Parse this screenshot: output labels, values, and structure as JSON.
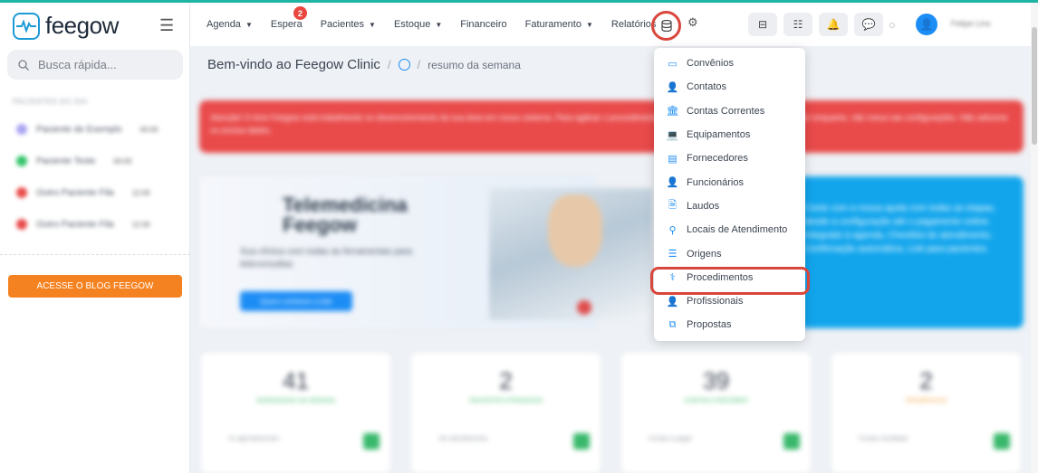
{
  "app": {
    "logo_text": "feegow"
  },
  "search": {
    "placeholder": "Busca rápida..."
  },
  "sidebar": {
    "section_title": "PACIENTES DO DIA",
    "patients": [
      {
        "name": "Paciente de Exemplo",
        "badge": "00:00",
        "color": "#a9a4f2"
      },
      {
        "name": "Paciente Teste",
        "badge": "00:00",
        "color": "#33c46a"
      },
      {
        "name": "Outro Paciente Fila",
        "badge": "12:00",
        "color": "#e94a4a"
      },
      {
        "name": "Outro Paciente Fila",
        "badge": "12:00",
        "color": "#e94a4a"
      }
    ],
    "blog_button": "ACESSE O BLOG FEEGOW"
  },
  "nav": {
    "items": [
      {
        "label": "Agenda",
        "has_caret": true
      },
      {
        "label": "Espera",
        "has_caret": false,
        "badge": "2"
      },
      {
        "label": "Pacientes",
        "has_caret": true
      },
      {
        "label": "Estoque",
        "has_caret": true
      },
      {
        "label": "Financeiro",
        "has_caret": false
      },
      {
        "label": "Faturamento",
        "has_caret": true
      },
      {
        "label": "Relatórios",
        "has_caret": false
      }
    ],
    "caret_glyph": "▼",
    "username": "Felipe Lins"
  },
  "breadcrumb": {
    "title": "Bem-vindo ao Feegow Clinic",
    "separator": "/",
    "subtitle": "resumo da semana"
  },
  "alert": {
    "text": "Atenção! O time Feegow está trabalhando no desenvolvimento da sua área em nosso sistema. Para agilizar o procedimento deste processo, pedimos o seu apoio por enquanto, não mexa nas configurações. Não adicione ou exclua dados."
  },
  "banner": {
    "title_line1": "Telemedicina",
    "title_line2": "Feegow",
    "text": "Sua clínica com todas as ferramentas para teleconsultas",
    "button": "Quero conhecer a tele",
    "right_text": "Conte com a nossa ajuda com todas as etapas, desde a configuração até o pagamento online. Integrado à agenda, Checklist de atendimento, Confirmação automática, Link para pacientes."
  },
  "cards": [
    {
      "number": "41",
      "label": "Agendados na semana",
      "foot": "41 agendamentos"
    },
    {
      "number": "2",
      "label": "Pacientes atendidos",
      "foot": "Ver atendimentos"
    },
    {
      "number": "39",
      "label": "Contas a receber",
      "foot": "Contas a pagar"
    },
    {
      "number": "2",
      "label": "Pendências",
      "foot": "Contas recebidas",
      "label_color": "#f2a23a"
    }
  ],
  "dropdown": {
    "items": [
      {
        "label": "Convênios",
        "icon": "card-icon",
        "glyph": "▭"
      },
      {
        "label": "Contatos",
        "icon": "user-icon",
        "glyph": "👤"
      },
      {
        "label": "Contas Correntes",
        "icon": "bank-icon",
        "glyph": "🏛"
      },
      {
        "label": "Equipamentos",
        "icon": "laptop-icon",
        "glyph": "💻"
      },
      {
        "label": "Fornecedores",
        "icon": "box-icon",
        "glyph": "▤"
      },
      {
        "label": "Funcionários",
        "icon": "user-icon",
        "glyph": "👤"
      },
      {
        "label": "Laudos",
        "icon": "document-icon",
        "glyph": "🗎"
      },
      {
        "label": "Locais de Atendimento",
        "icon": "map-pin-icon",
        "glyph": "⚲"
      },
      {
        "label": "Origens",
        "icon": "list-icon",
        "glyph": "☰"
      },
      {
        "label": "Procedimentos",
        "icon": "stethoscope-icon",
        "glyph": "⚕",
        "highlight": true
      },
      {
        "label": "Profissionais",
        "icon": "user-doctor-icon",
        "glyph": "👤"
      },
      {
        "label": "Propostas",
        "icon": "copy-icon",
        "glyph": "⧉"
      }
    ]
  },
  "colors": {
    "accent": "#1c8df5",
    "highlight_ring": "#d9463b",
    "alert": "#e94a4a",
    "blog_button": "#f58220"
  }
}
